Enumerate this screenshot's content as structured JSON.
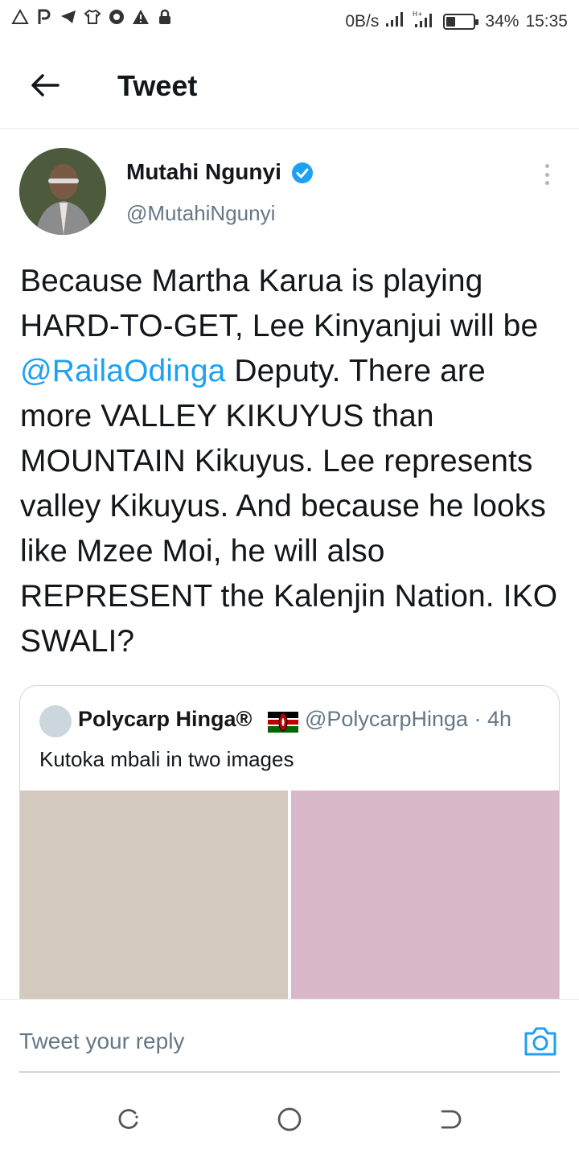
{
  "status_bar": {
    "left_icons": [
      "warning-icon",
      "p-icon",
      "telegram-icon",
      "shirt-icon",
      "chrome-icon",
      "alert-icon",
      "lock-icon"
    ],
    "net_speed": "0B/s",
    "battery_level": 0.34,
    "battery_percent": "34%",
    "time": "15:35"
  },
  "header": {
    "title": "Tweet"
  },
  "tweet": {
    "author_name": "Mutahi Ngunyi",
    "author_handle": "@MutahiNgunyi",
    "verified": true,
    "text_before_mention": "Because Martha Karua is playing HARD-TO-GET, Lee Kinyanjui will be ",
    "mention": "@RailaOdinga",
    "text_after_mention": " Deputy. There are more VALLEY KIKUYUS than MOUNTAIN Kikuyus. Lee represents valley Kikuyus. And because he looks like Mzee Moi, he will also REPRESENT the Kalenjin Nation. IKO SWALI?"
  },
  "quote": {
    "author_name": "Polycarp Hinga®",
    "author_handle": "@PolycarpHinga · 4h",
    "text": "Kutoka mbali in two images",
    "image_colors": [
      "#d3c9be",
      "#d9b8ca"
    ]
  },
  "reply": {
    "placeholder": "Tweet your reply"
  },
  "colors": {
    "accent": "#1da1f2",
    "secondary_text": "#657786",
    "border": "#e1e8ed"
  }
}
